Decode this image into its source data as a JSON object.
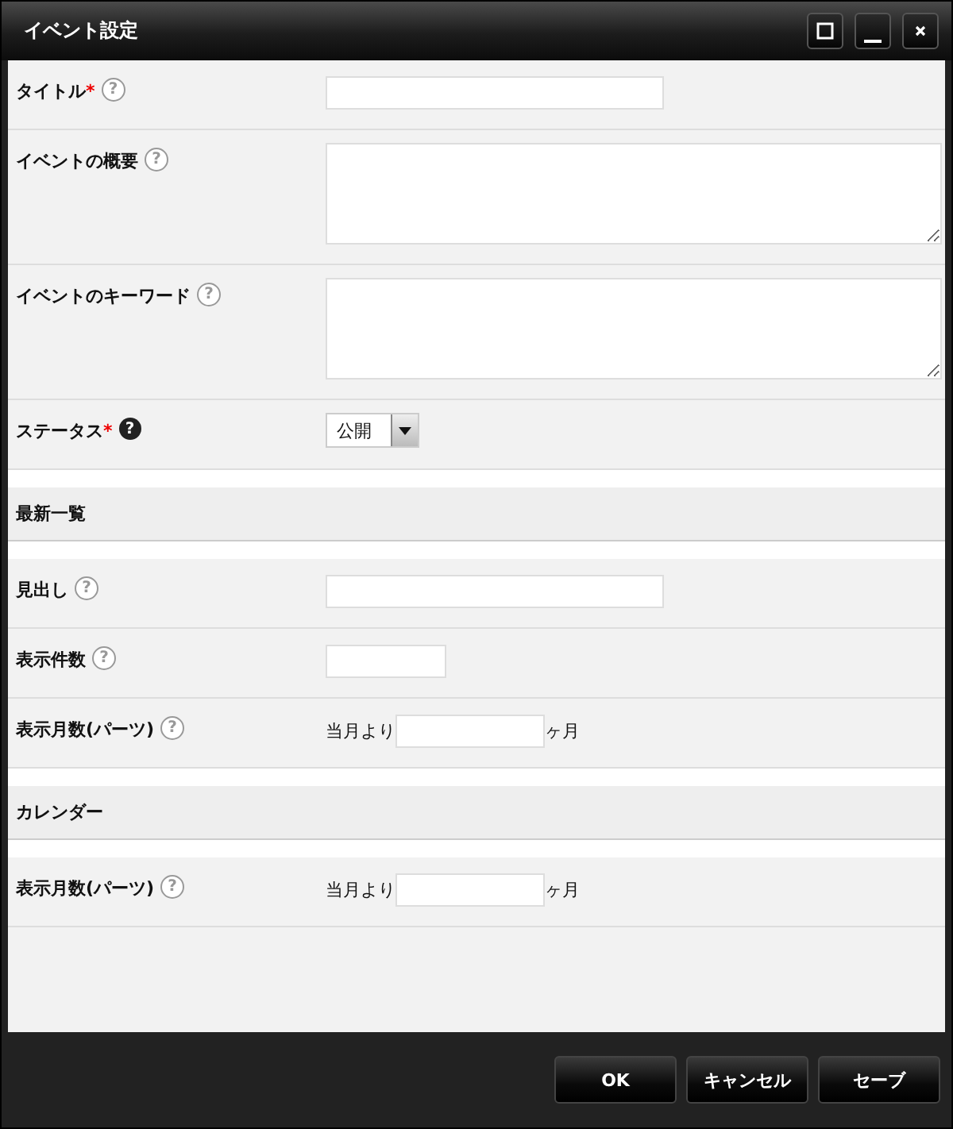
{
  "window": {
    "title": "イベント設定"
  },
  "rows": [
    {
      "kind": "field",
      "label": "タイトル",
      "required": true,
      "help": "?",
      "help_dark": false,
      "control": {
        "kind": "text"
      }
    },
    {
      "kind": "field",
      "label": "イベントの概要",
      "required": false,
      "help": "?",
      "help_dark": false,
      "control": {
        "kind": "textarea"
      }
    },
    {
      "kind": "field",
      "label": "イベントのキーワード",
      "required": false,
      "help": "?",
      "help_dark": false,
      "control": {
        "kind": "textarea"
      }
    },
    {
      "kind": "field",
      "label": "ステータス",
      "required": true,
      "help": "?",
      "help_dark": true,
      "control": {
        "kind": "select",
        "value": "公開"
      }
    },
    {
      "kind": "section",
      "label": "最新一覧"
    },
    {
      "kind": "field",
      "label": "見出し",
      "required": false,
      "help": "?",
      "help_dark": false,
      "control": {
        "kind": "text"
      }
    },
    {
      "kind": "field",
      "label": "表示件数",
      "required": false,
      "help": "?",
      "help_dark": false,
      "control": {
        "kind": "short"
      }
    },
    {
      "kind": "field",
      "label": "表示月数(パーツ)",
      "required": false,
      "help": "?",
      "help_dark": false,
      "control": {
        "kind": "months",
        "prefix": "当月より",
        "suffix": "ヶ月"
      }
    },
    {
      "kind": "section",
      "label": "カレンダー"
    },
    {
      "kind": "field",
      "label": "表示月数(パーツ)",
      "required": false,
      "help": "?",
      "help_dark": false,
      "control": {
        "kind": "months",
        "prefix": "当月より",
        "suffix": "ヶ月"
      }
    }
  ],
  "required_mark": "*",
  "buttons": [
    "OK",
    "キャンセル",
    "セーブ"
  ]
}
